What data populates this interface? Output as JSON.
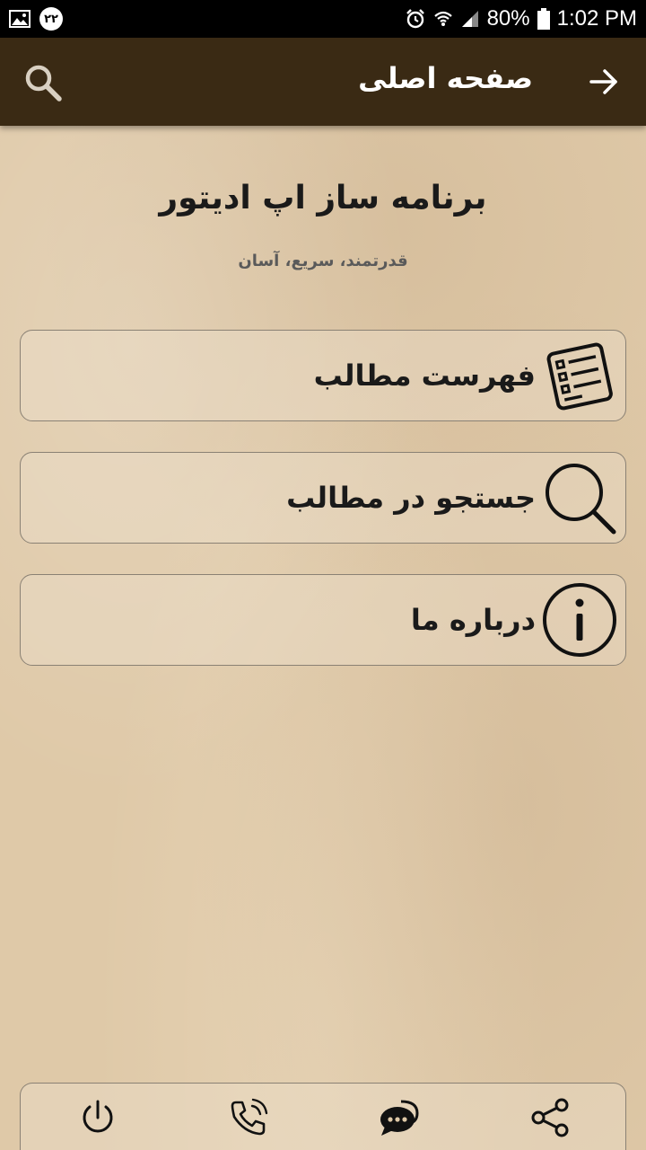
{
  "status_bar": {
    "notification_count": "۲۲",
    "battery": "80%",
    "time": "1:02 PM",
    "icons": [
      "image-icon",
      "alarm-icon",
      "wifi-icon",
      "signal-icon",
      "battery-icon"
    ]
  },
  "app_bar": {
    "title": "صفحه اصلی",
    "icons": [
      "search-icon",
      "arrow-right-icon"
    ],
    "color": "#3a2a14"
  },
  "header": {
    "app_name": "برنامه ساز اپ ادیتور",
    "tagline": "قدرتمند، سریع، آسان"
  },
  "menu": {
    "items": [
      {
        "label": "فهرست مطالب",
        "icon": "list-icon"
      },
      {
        "label": "جستجو در مطالب",
        "icon": "search-icon"
      },
      {
        "label": "درباره ما",
        "icon": "info-icon"
      }
    ]
  },
  "bottom_bar": {
    "icons": [
      "power-icon",
      "phone-icon",
      "chat-icon",
      "share-icon"
    ]
  }
}
